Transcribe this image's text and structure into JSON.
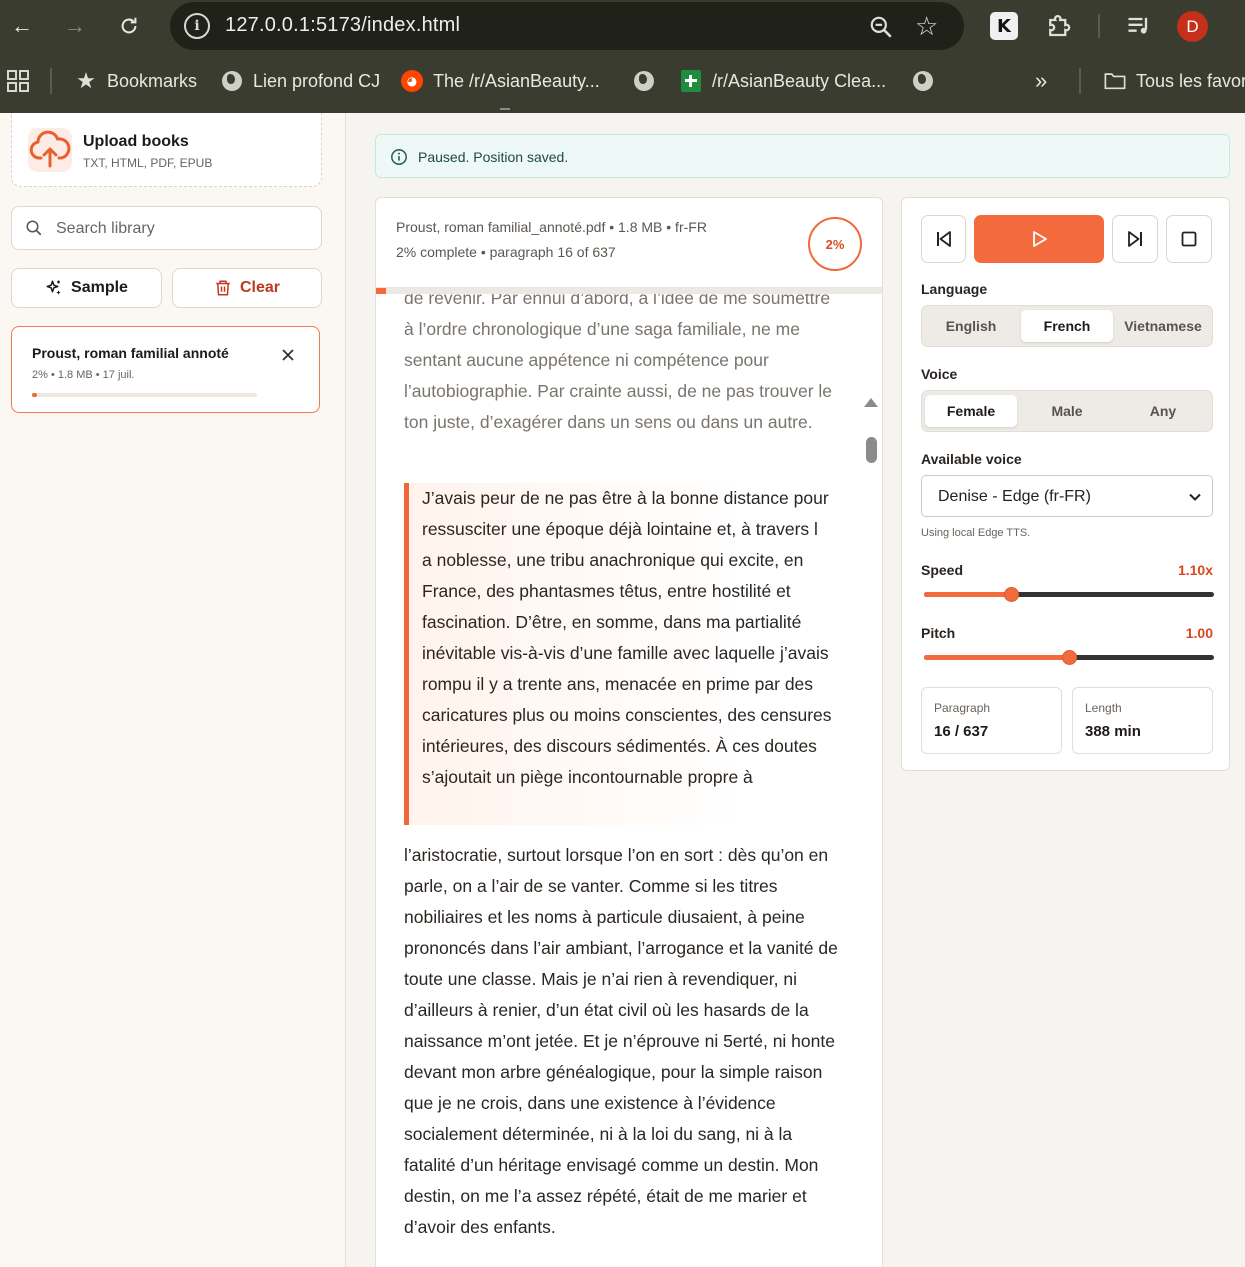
{
  "browser": {
    "url": "127.0.0.1:5173/index.html",
    "avatar_initial": "D",
    "extension_label": "K",
    "bookmarks": [
      {
        "label": "Bookmarks",
        "icon": "star-icon"
      },
      {
        "label": "Lien profond CJ",
        "icon": "globe-icon"
      },
      {
        "label": "The /r/AsianBeauty...",
        "icon": "reddit-icon"
      },
      {
        "label": "",
        "icon": "globe-icon"
      },
      {
        "label": "/r/AsianBeauty Clea...",
        "icon": "sheets-icon"
      },
      {
        "label": "",
        "icon": "globe-icon"
      },
      {
        "label": "Tous les favoris",
        "icon": "folder-icon"
      }
    ],
    "overflow_label": "»"
  },
  "sidebar": {
    "upload_title": "Upload books",
    "upload_formats": "TXT, HTML, PDF, EPUB",
    "search_placeholder": "Search library",
    "sample_label": "Sample",
    "clear_label": "Clear",
    "books": [
      {
        "title": "Proust, roman familial annoté",
        "meta": "2% • 1.8 MB • 17 juil.",
        "progress": 0.02
      }
    ]
  },
  "status": {
    "message": "Paused. Position saved."
  },
  "reader": {
    "file_info": "Proust, roman familial_annoté.pdf • 1.8 MB • fr-FR",
    "progress_info": "2% complete • paragraph 16 of 637",
    "percent_label": "2%",
    "progress": 0.02,
    "prev_paragraph": "de revenir. Par ennui d’abord, à l’idée de me soumettre à l’ordre chronologique d’une saga familiale, ne me sentant aucune appétence ni compétence pour l’autobiographie. Par crainte aussi, de ne pas trouver le ton juste, d’exagérer dans un sens ou dans un autre.",
    "current_paragraph": "J’avais peur de ne pas être à la bonne distance pour ressusciter une époque déjà lointaine et, à travers l a noblesse, une tribu anachronique qui excite, en France, des phantasmes têtus, entre hostilité et fascination. D’être, en somme, dans ma partialité inévitable vis-à-vis d’une famille avec laquelle j’avais rompu il y a trente ans, menacée en prime par des caricatures plus ou moins conscientes, des censures intérieures, des discours sédimentés. À ces doutes s’ajoutait un piège incontournable propre à",
    "next_paragraph": "l’aristocratie, surtout lorsque l’on en sort : dès qu’on en parle, on a l’air de se vanter. Comme si les titres nobiliaires et les noms à particule diusaient, à peine prononcés dans l’air ambiant, l’arrogance et la vanité de toute une classe. Mais je n’ai rien à revendiquer, ni d’ailleurs à renier, d’un état civil où les hasards de la naissance m’ont jetée. Et je n’éprouve ni 5erté, ni honte devant mon arbre généalogique, pour la simple raison que je ne crois, dans une existence à l’évidence socialement déterminée, ni à la loi du sang, ni à la fatalité d’un héritage envisagé comme un destin. Mon destin, on me l’a assez répété, était de me marier et d’avoir des enfants."
  },
  "player": {
    "language_label": "Language",
    "languages": [
      "English",
      "French",
      "Vietnamese"
    ],
    "language_selected": "French",
    "voice_label": "Voice",
    "voices": [
      "Female",
      "Male",
      "Any"
    ],
    "voice_selected": "Female",
    "available_voice_label": "Available voice",
    "available_voice_value": "Denise - Edge (fr-FR)",
    "tts_note": "Using local Edge TTS.",
    "speed_label": "Speed",
    "speed_value": "1.10x",
    "speed": 1.1,
    "speed_range": [
      0.5,
      2.5
    ],
    "pitch_label": "Pitch",
    "pitch_value": "1.00",
    "pitch": 1.0,
    "pitch_range": [
      0,
      2
    ],
    "paragraph_label": "Paragraph",
    "paragraph_value": "16 / 637",
    "length_label": "Length",
    "length_value": "388 min",
    "accent_color": "#f36b3c"
  }
}
